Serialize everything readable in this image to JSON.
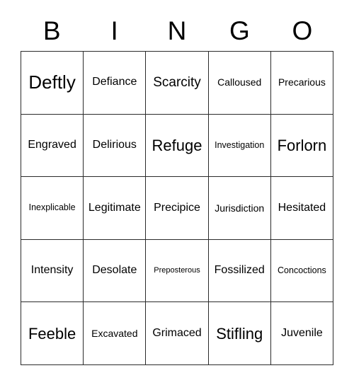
{
  "card": {
    "header": {
      "letters": [
        "B",
        "I",
        "N",
        "G",
        "O"
      ]
    },
    "grid": {
      "rows": [
        [
          {
            "text": "Deftly",
            "size": "fs-xxl"
          },
          {
            "text": "Defiance",
            "size": "fs-m"
          },
          {
            "text": "Scarcity",
            "size": "fs-l"
          },
          {
            "text": "Calloused",
            "size": "fs-s"
          },
          {
            "text": "Precarious",
            "size": "fs-s"
          }
        ],
        [
          {
            "text": "Engraved",
            "size": "fs-m"
          },
          {
            "text": "Delirious",
            "size": "fs-m"
          },
          {
            "text": "Refuge",
            "size": "fs-xl"
          },
          {
            "text": "Investigation",
            "size": "fs-xs"
          },
          {
            "text": "Forlorn",
            "size": "fs-xl"
          }
        ],
        [
          {
            "text": "Inexplicable",
            "size": "fs-xs"
          },
          {
            "text": "Legitimate",
            "size": "fs-m"
          },
          {
            "text": "Precipice",
            "size": "fs-m"
          },
          {
            "text": "Jurisdiction",
            "size": "fs-s"
          },
          {
            "text": "Hesitated",
            "size": "fs-m"
          }
        ],
        [
          {
            "text": "Intensity",
            "size": "fs-m"
          },
          {
            "text": "Desolate",
            "size": "fs-m"
          },
          {
            "text": "Preposterous",
            "size": "fs-xxs"
          },
          {
            "text": "Fossilized",
            "size": "fs-m"
          },
          {
            "text": "Concoctions",
            "size": "fs-xs"
          }
        ],
        [
          {
            "text": "Feeble",
            "size": "fs-xl"
          },
          {
            "text": "Excavated",
            "size": "fs-s"
          },
          {
            "text": "Grimaced",
            "size": "fs-m"
          },
          {
            "text": "Stifling",
            "size": "fs-xl"
          },
          {
            "text": "Juvenile",
            "size": "fs-m"
          }
        ]
      ]
    },
    "colors": {
      "background": "#ffffff",
      "text": "#000000",
      "border": "#2b2b2b"
    }
  }
}
